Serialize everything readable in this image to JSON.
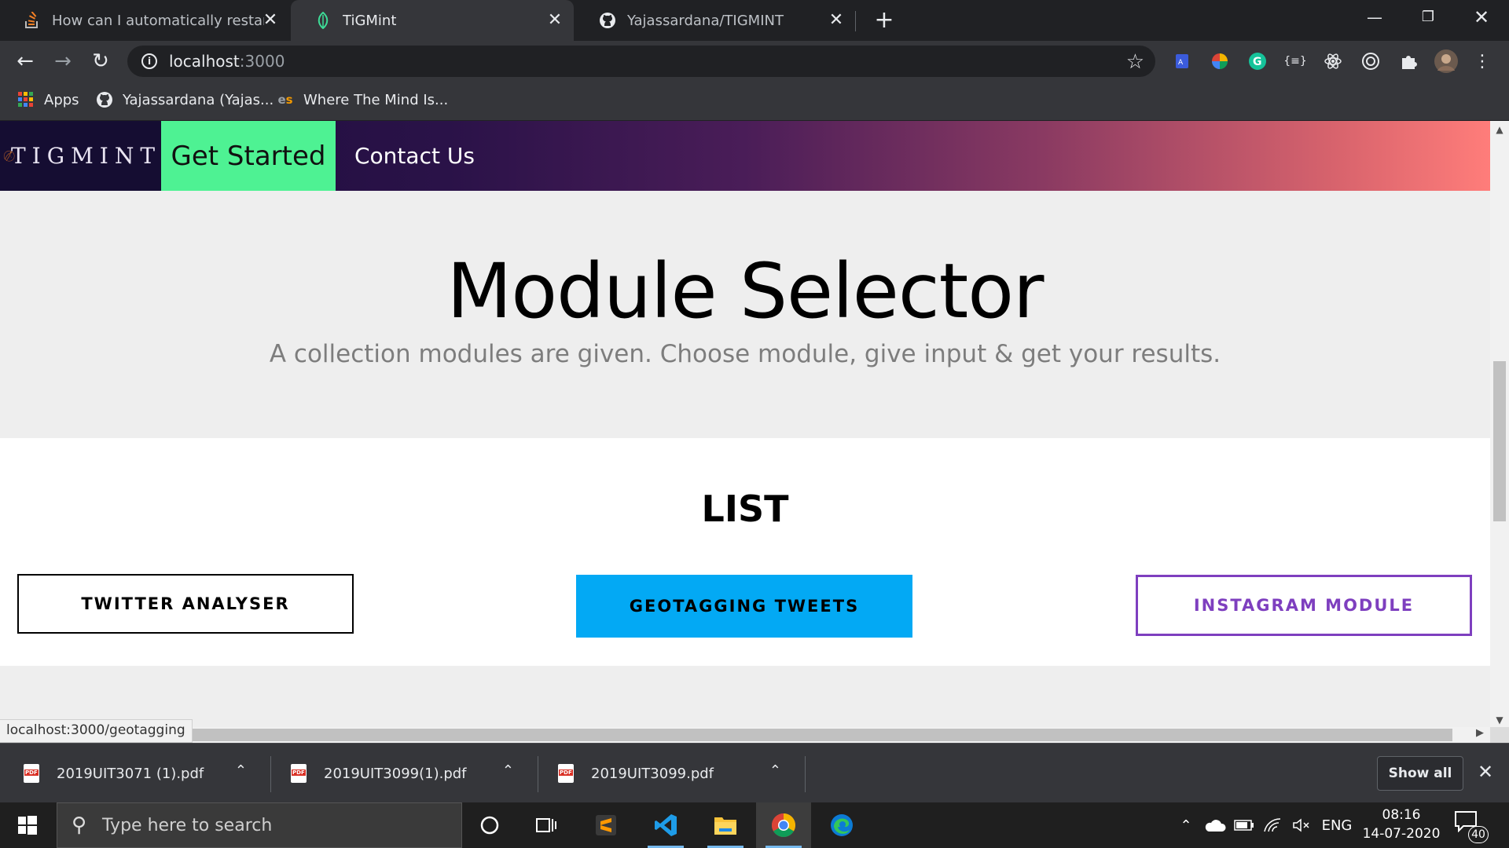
{
  "browser": {
    "tabs": [
      {
        "title": "How can I automatically restart a",
        "icon": "stackoverflow-icon",
        "active": false
      },
      {
        "title": "TiGMint",
        "icon": "tigmint-leaf-icon",
        "active": true
      },
      {
        "title": "Yajassardana/TIGMINT",
        "icon": "github-icon",
        "active": false
      }
    ],
    "new_tab_icon": "plus-icon",
    "window_controls": [
      "minimize-icon",
      "restore-icon",
      "close-icon"
    ],
    "url_host": "localhost",
    "url_port": ":3000",
    "bookmarks": [
      {
        "label": "Apps",
        "icon": "apps-grid-icon"
      },
      {
        "label": "Yajassardana (Yajas...",
        "icon": "github-icon"
      },
      {
        "label": "Where The Mind Is...",
        "icon": "es-icon"
      }
    ],
    "status_url": "localhost:3000/geotagging"
  },
  "page": {
    "nav": {
      "brand": "TIGMINT",
      "get_started": "Get Started",
      "contact_us": "Contact Us"
    },
    "hero": {
      "title": "Module Selector",
      "subtitle": "A collection modules are given. Choose module, give input & get your results."
    },
    "list": {
      "title": "LIST",
      "modules": [
        "TWITTER ANALYSER",
        "GEOTAGGING TWEETS",
        "INSTAGRAM MODULE"
      ]
    },
    "colors": {
      "get_started_bg": "#4ef293",
      "geotagging_bg": "#03a9f4",
      "instagram_border": "#7e3fbf"
    }
  },
  "downloads": {
    "files": [
      "2019UIT3071 (1).pdf",
      "2019UIT3099(1).pdf",
      "2019UIT3099.pdf"
    ],
    "show_all": "Show all"
  },
  "taskbar": {
    "search_placeholder": "Type here to search",
    "apps": [
      "cortana-icon",
      "task-view-icon",
      "sublime-text-icon",
      "vscode-icon",
      "file-explorer-icon",
      "chrome-icon",
      "edge-icon"
    ],
    "language": "ENG",
    "time": "08:16",
    "date": "14-07-2020",
    "notification_count": "40"
  }
}
